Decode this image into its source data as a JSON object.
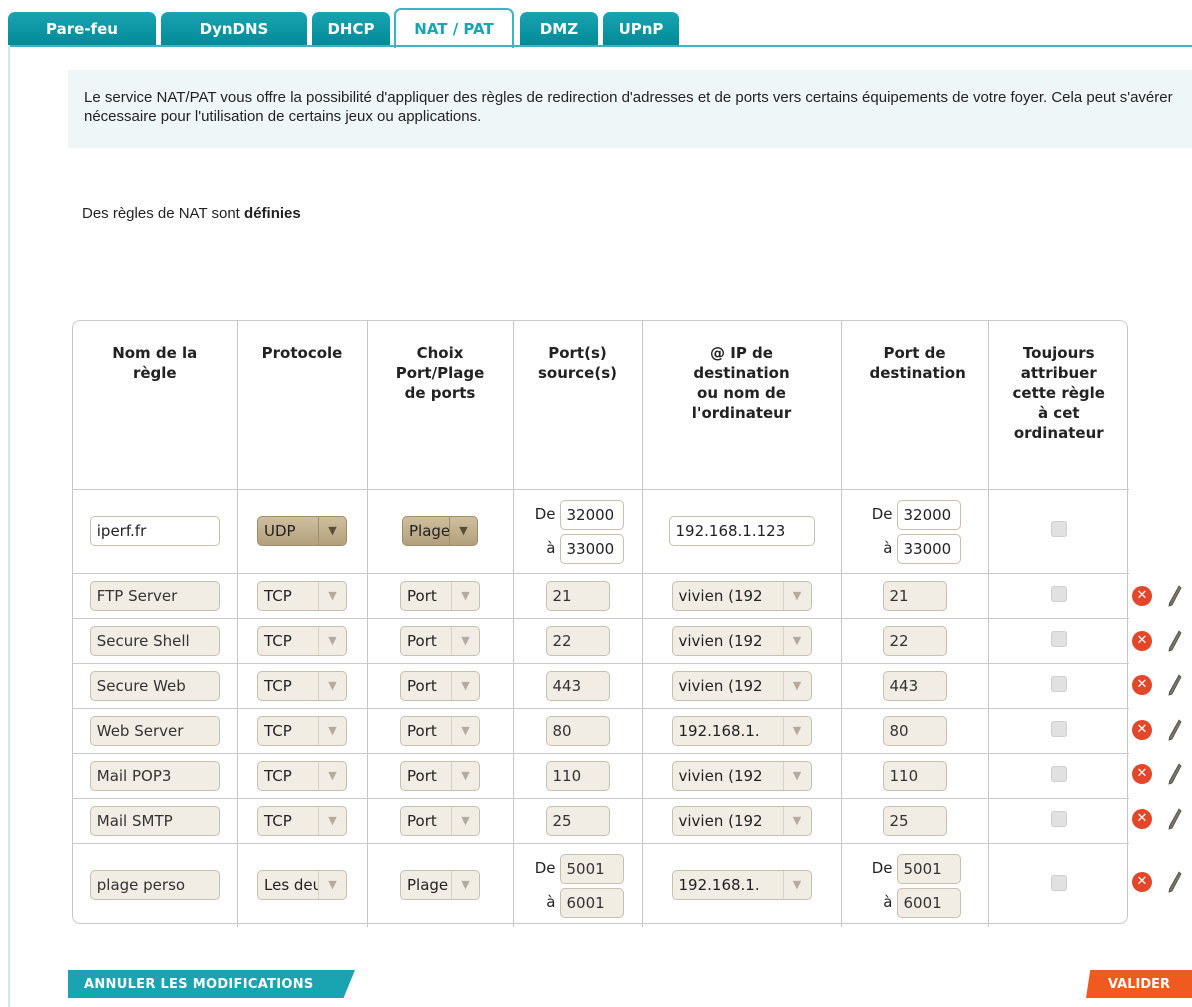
{
  "tabs": [
    "Pare-feu",
    "DynDNS",
    "DHCP",
    "NAT / PAT",
    "DMZ",
    "UPnP"
  ],
  "active_tab": "NAT / PAT",
  "info_text": "Le service NAT/PAT vous offre la possibilité d'appliquer des règles de redirection d'adresses et de ports vers certains équipements de votre foyer. Cela peut s'avérer nécessaire pour l'utilisation de certains jeux ou applications.",
  "status": {
    "prefix": "Des règles de NAT sont",
    "value": "définies"
  },
  "columns": [
    "Nom de la règle",
    "Protocole",
    "Choix Port/Plage de ports",
    "Port(s) source(s)",
    "@ IP de destination ou nom de l'ordinateur",
    "Port de destination",
    "Toujours attribuer cette règle à cet ordinateur"
  ],
  "range_labels": {
    "from": "De",
    "to": "à"
  },
  "new_rule": {
    "name": "iperf.fr",
    "protocol": "UDP",
    "mode": "Plage",
    "src_from": "32000",
    "src_to": "33000",
    "ip": "192.168.1.123",
    "dst_from": "32000",
    "dst_to": "33000"
  },
  "rules": [
    {
      "name": "FTP Server",
      "protocol": "TCP",
      "mode": "Port",
      "src": "21",
      "ip": "vivien (192",
      "dst": "21"
    },
    {
      "name": "Secure Shell",
      "protocol": "TCP",
      "mode": "Port",
      "src": "22",
      "ip": "vivien (192",
      "dst": "22"
    },
    {
      "name": "Secure Web",
      "protocol": "TCP",
      "mode": "Port",
      "src": "443",
      "ip": "vivien (192",
      "dst": "443"
    },
    {
      "name": "Web Server",
      "protocol": "TCP",
      "mode": "Port",
      "src": "80",
      "ip": "192.168.1.",
      "dst": "80"
    },
    {
      "name": "Mail POP3",
      "protocol": "TCP",
      "mode": "Port",
      "src": "110",
      "ip": "vivien (192",
      "dst": "110"
    },
    {
      "name": "Mail SMTP",
      "protocol": "TCP",
      "mode": "Port",
      "src": "25",
      "ip": "vivien (192",
      "dst": "25"
    }
  ],
  "range_rule": {
    "name": "plage perso",
    "protocol": "Les deux",
    "mode": "Plage",
    "src_from": "5001",
    "src_to": "6001",
    "ip": "192.168.1.",
    "dst_from": "5001",
    "dst_to": "6001"
  },
  "buttons": {
    "cancel": "ANNULER LES MODIFICATIONS",
    "submit": "VALIDER"
  },
  "colors": {
    "accent": "#1aa3b0",
    "submit": "#f05a1e",
    "delete": "#e2472a"
  }
}
